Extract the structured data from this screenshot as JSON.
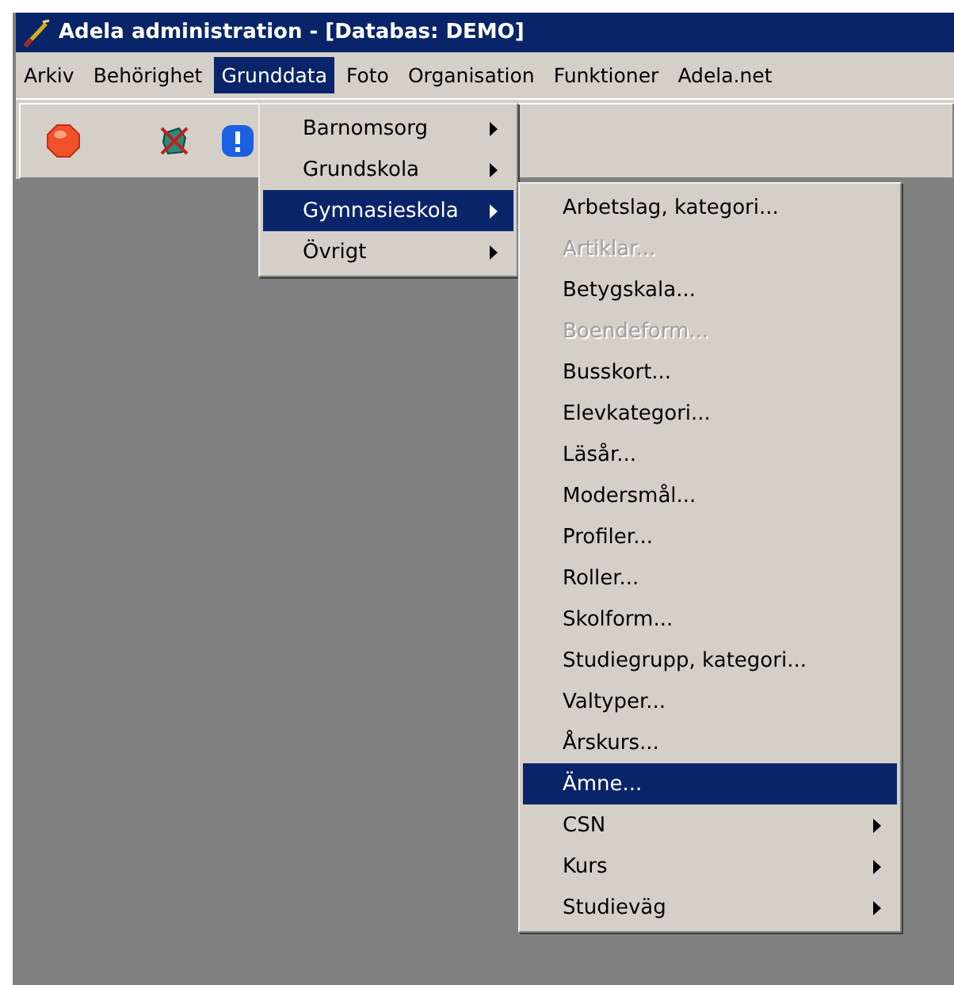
{
  "window": {
    "title": "Adela administration - [Databas: DEMO]"
  },
  "menubar": [
    {
      "label": "Arkiv",
      "selected": false
    },
    {
      "label": "Behörighet",
      "selected": false
    },
    {
      "label": "Grunddata",
      "selected": true
    },
    {
      "label": "Foto",
      "selected": false
    },
    {
      "label": "Organisation",
      "selected": false
    },
    {
      "label": "Funktioner",
      "selected": false
    },
    {
      "label": "Adela.net",
      "selected": false
    }
  ],
  "grunddata_menu": [
    {
      "label": "Barnomsorg",
      "selected": false,
      "submenu": true
    },
    {
      "label": "Grundskola",
      "selected": false,
      "submenu": true
    },
    {
      "label": "Gymnasieskola",
      "selected": true,
      "submenu": true
    },
    {
      "label": "Övrigt",
      "selected": false,
      "submenu": true
    }
  ],
  "gymnasieskola_menu": [
    {
      "label": "Arbetslag, kategori...",
      "disabled": false,
      "selected": false,
      "submenu": false
    },
    {
      "label": "Artiklar...",
      "disabled": true,
      "selected": false,
      "submenu": false
    },
    {
      "label": "Betygskala...",
      "disabled": false,
      "selected": false,
      "submenu": false
    },
    {
      "label": "Boendeform...",
      "disabled": true,
      "selected": false,
      "submenu": false
    },
    {
      "label": "Busskort...",
      "disabled": false,
      "selected": false,
      "submenu": false
    },
    {
      "label": "Elevkategori...",
      "disabled": false,
      "selected": false,
      "submenu": false
    },
    {
      "label": "Läsår...",
      "disabled": false,
      "selected": false,
      "submenu": false
    },
    {
      "label": "Modersmål...",
      "disabled": false,
      "selected": false,
      "submenu": false
    },
    {
      "label": "Profiler...",
      "disabled": false,
      "selected": false,
      "submenu": false
    },
    {
      "label": "Roller...",
      "disabled": false,
      "selected": false,
      "submenu": false
    },
    {
      "label": "Skolform...",
      "disabled": false,
      "selected": false,
      "submenu": false
    },
    {
      "label": "Studiegrupp, kategori...",
      "disabled": false,
      "selected": false,
      "submenu": false
    },
    {
      "label": "Valtyper...",
      "disabled": false,
      "selected": false,
      "submenu": false
    },
    {
      "label": "Årskurs...",
      "disabled": false,
      "selected": false,
      "submenu": false
    },
    {
      "label": "Ämne...",
      "disabled": false,
      "selected": true,
      "submenu": false
    },
    {
      "label": "CSN",
      "disabled": false,
      "selected": false,
      "submenu": true
    },
    {
      "label": "Kurs",
      "disabled": false,
      "selected": false,
      "submenu": true
    },
    {
      "label": "Studieväg",
      "disabled": false,
      "selected": false,
      "submenu": true
    }
  ]
}
